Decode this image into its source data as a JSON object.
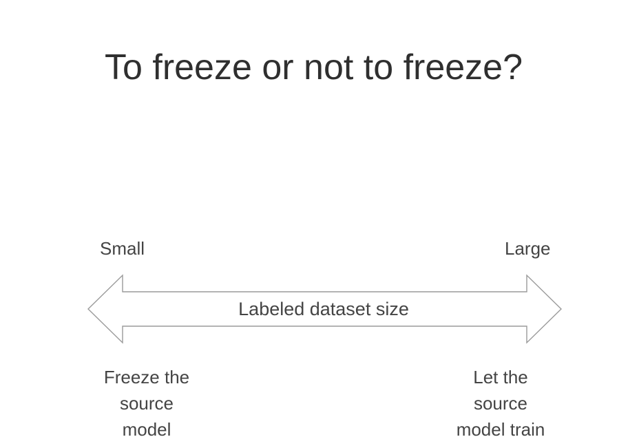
{
  "slide": {
    "title": "To freeze or not to freeze?",
    "scale": {
      "left_label": "Small",
      "right_label": "Large",
      "axis_label": "Labeled dataset size"
    },
    "captions": {
      "left": [
        "Freeze the",
        "source",
        "model"
      ],
      "right": [
        "Let the",
        "source",
        "model train"
      ]
    }
  }
}
